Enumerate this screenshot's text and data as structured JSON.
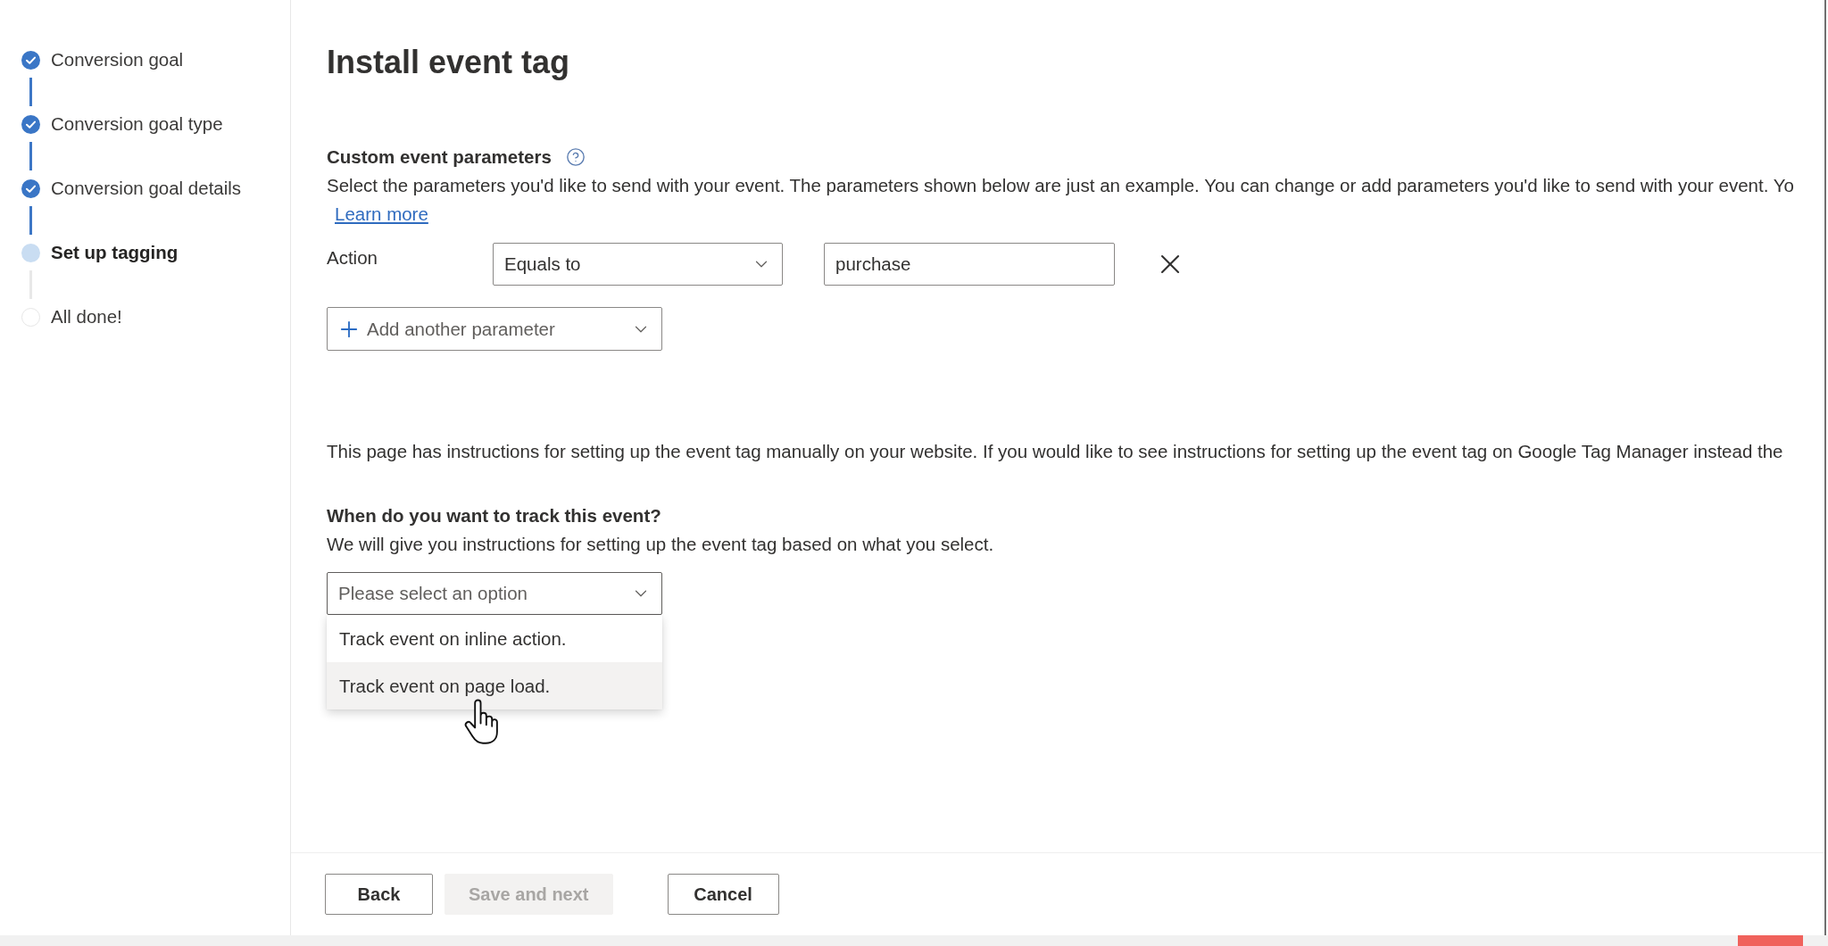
{
  "sidebar": {
    "steps": [
      {
        "label": "Conversion goal",
        "completed": true,
        "selected": false
      },
      {
        "label": "Conversion goal type",
        "completed": true,
        "selected": false
      },
      {
        "label": "Conversion goal details",
        "completed": true,
        "selected": false
      },
      {
        "label": "Set up tagging",
        "completed": false,
        "selected": true
      },
      {
        "label": "All done!",
        "completed": false,
        "selected": false
      }
    ]
  },
  "header": {
    "title": "Install event tag"
  },
  "custom_event_parameters": {
    "heading": "Custom event parameters",
    "description": "Select the parameters you'd like to send with your event. The parameters shown below are just an example. You can change or add parameters you'd like to send with your event. Yo",
    "learn_more_link": "Learn more",
    "parameters": [
      {
        "label": "Action",
        "operator": "Equals to",
        "value": "purchase"
      }
    ],
    "add_button": "Add another parameter"
  },
  "instructions_note": "This page has instructions for setting up the event tag manually on your website. If you would like to see instructions for setting up the event tag on Google Tag Manager instead the",
  "tracking": {
    "heading": "When do you want to track this event?",
    "description": "We will give you instructions for setting up the event tag based on what you select.",
    "select": {
      "placeholder": "Please select an option",
      "expanded": true,
      "options": [
        {
          "label": "Track event on inline action.",
          "highlighted": false
        },
        {
          "label": "Track event on page load.",
          "highlighted": true
        }
      ]
    }
  },
  "footer": {
    "nav_buttons": [
      {
        "label": "Back",
        "disabled": false
      },
      {
        "label": "Save and next",
        "disabled": true
      }
    ],
    "cancel_button": {
      "label": "Cancel",
      "disabled": false
    }
  }
}
